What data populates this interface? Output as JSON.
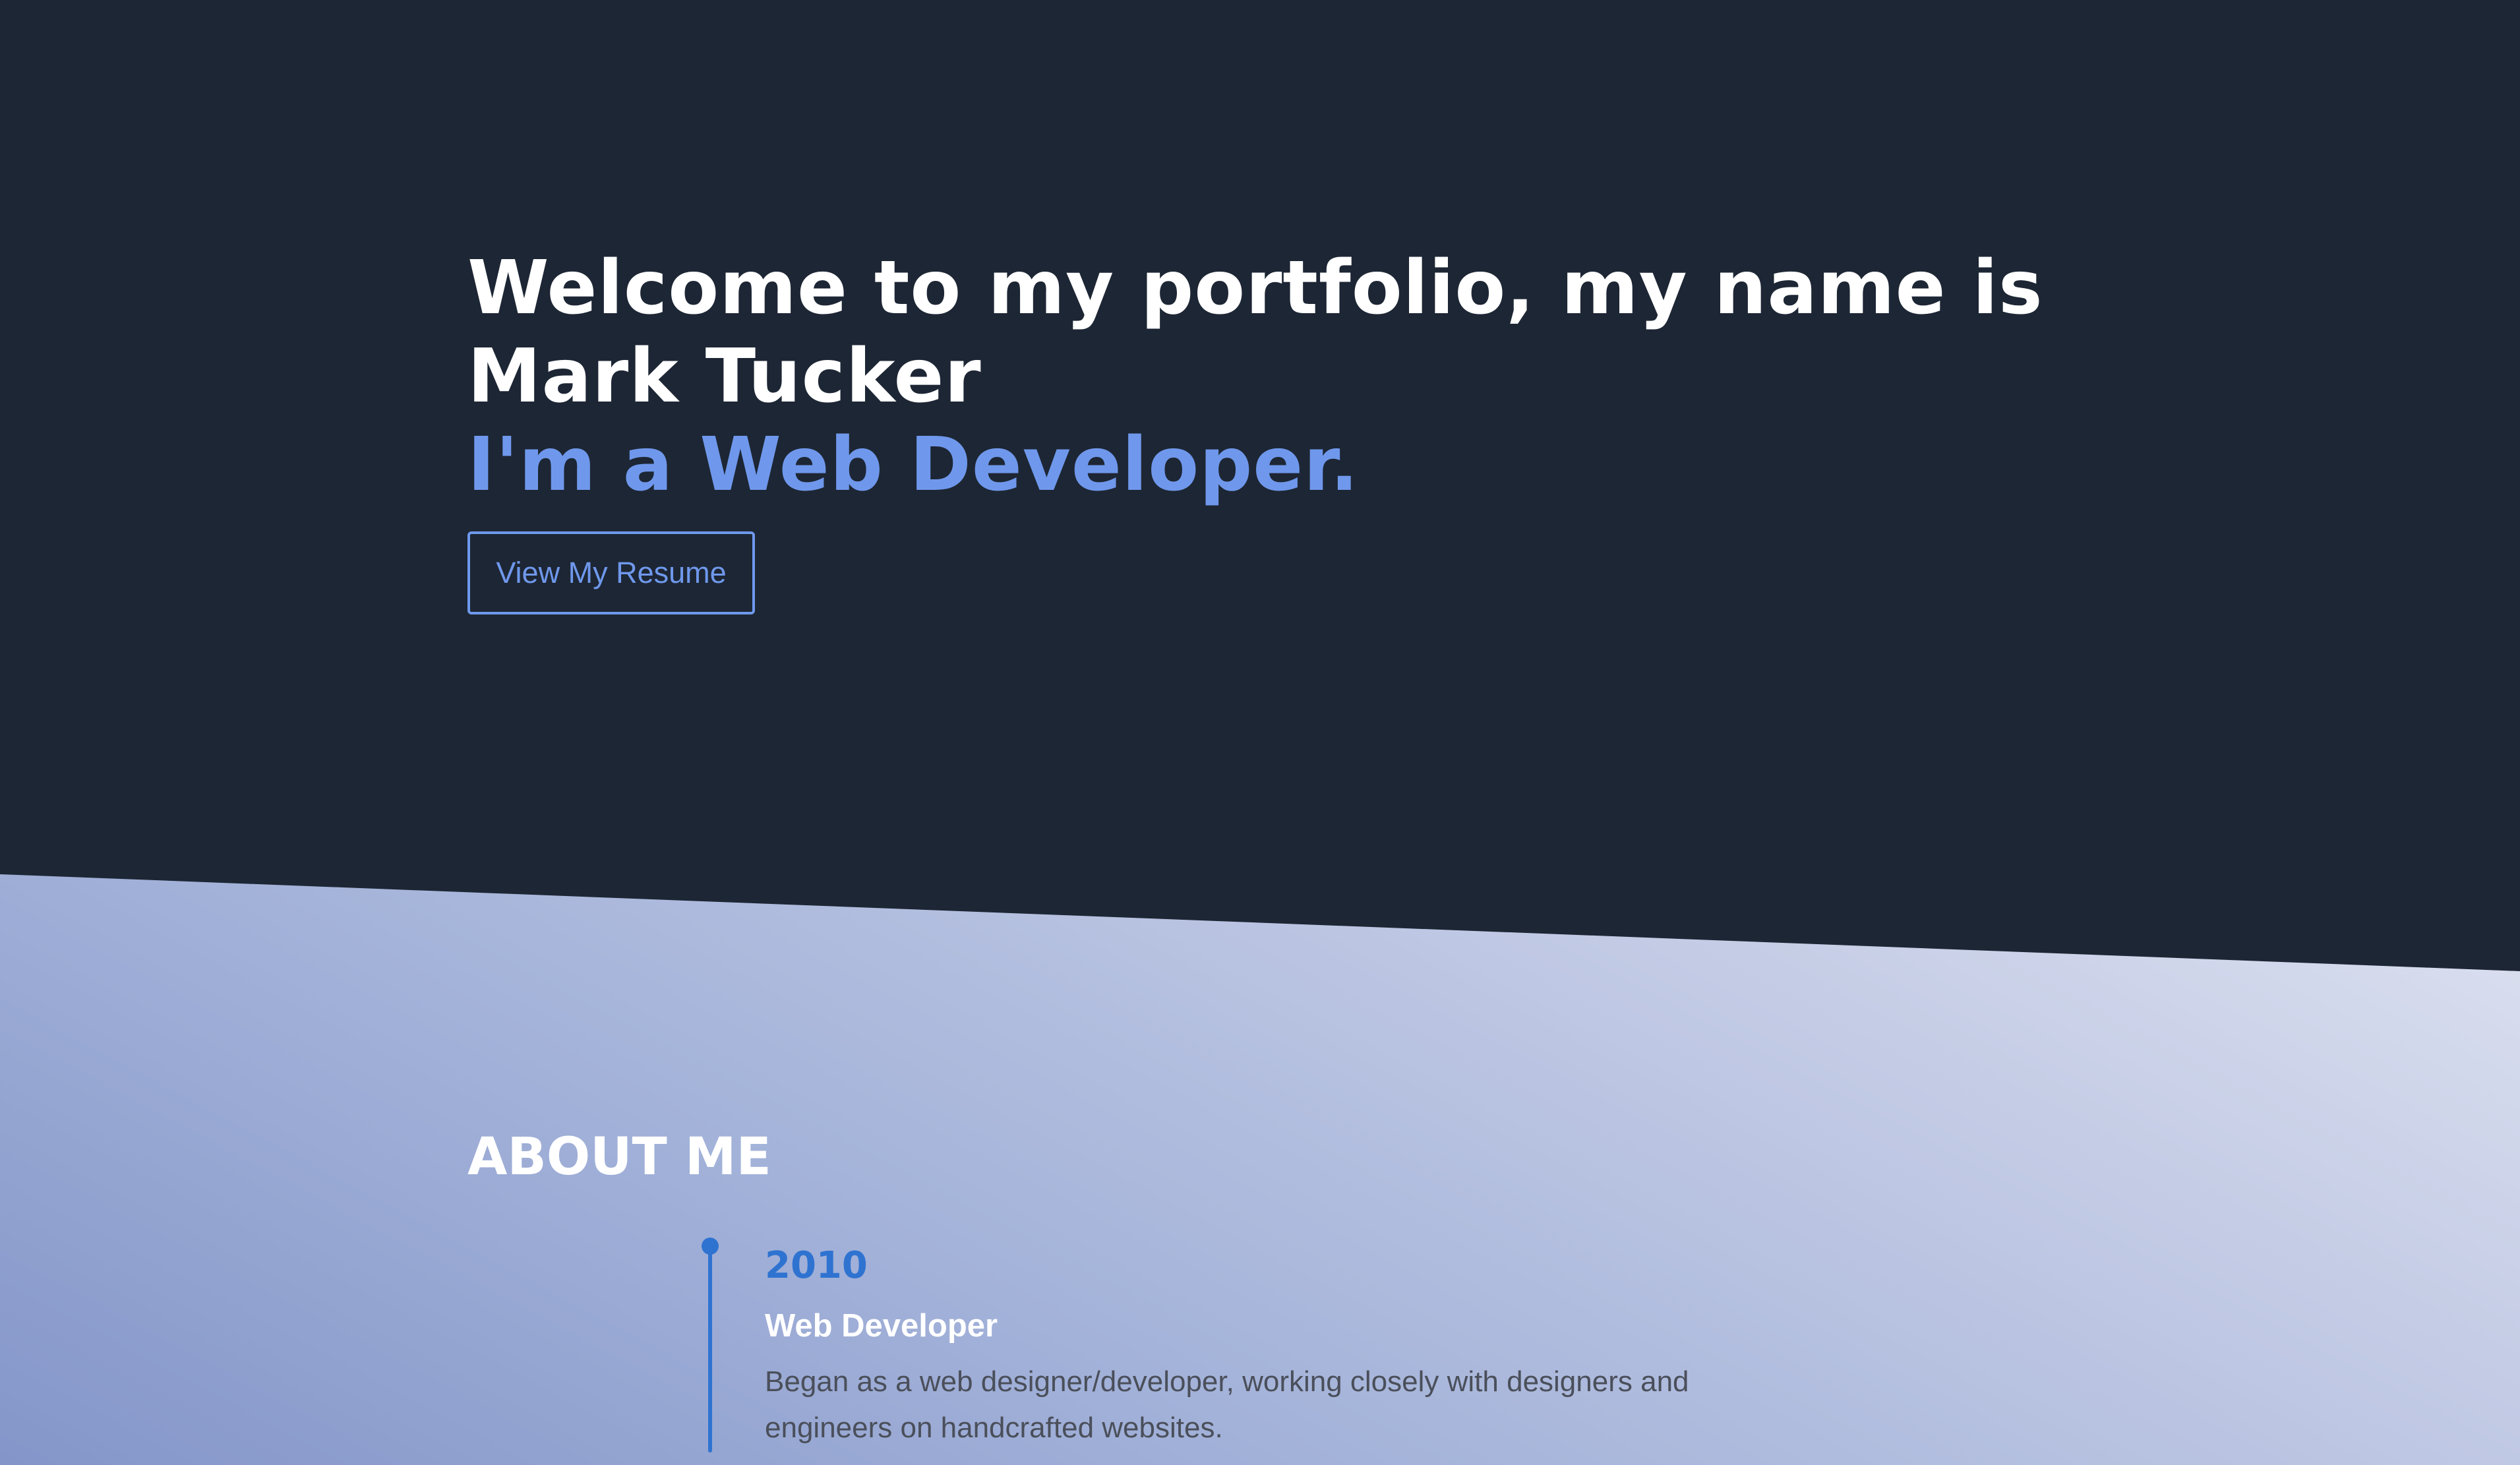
{
  "hero": {
    "title": "Welcome to my portfolio, my name is Mark Tucker",
    "subtitle": "I'm a Web Developer.",
    "resume_button": "View My Resume"
  },
  "about": {
    "title": "ABOUT ME",
    "timeline": [
      {
        "year": "2010",
        "role": "Web Developer",
        "description": "Began as a web designer/developer, working closely with designers and engineers on handcrafted websites."
      }
    ]
  },
  "colors": {
    "dark_background": "#1d2634",
    "accent": "#6f98ec",
    "timeline_blue": "#2f73d1",
    "gradient_start": "#8496c9",
    "gradient_end": "#fbfbfd"
  }
}
